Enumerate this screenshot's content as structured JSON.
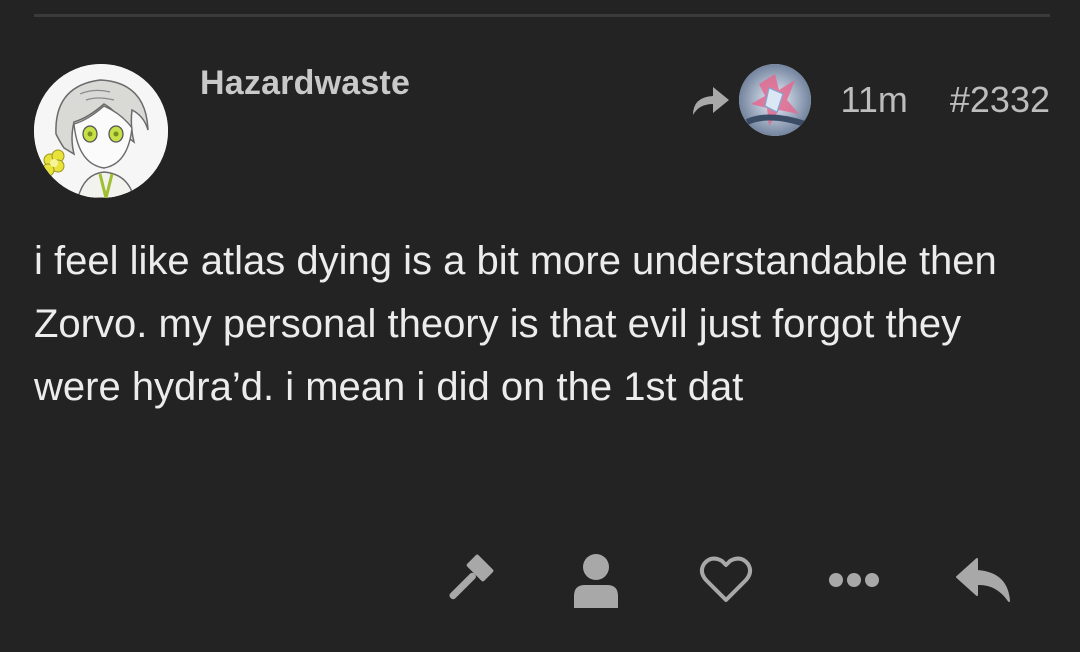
{
  "post": {
    "author": "Hazardwaste",
    "timestamp": "11m",
    "post_number": "#2332",
    "body": "i feel like atlas dying is a bit more understandable then Zorvo. my personal theory is that evil just forgot they were hydra’d. i mean i did on the 1st dat"
  },
  "icons": {
    "reply_to": "share-arrow-icon",
    "flag": "gavel-icon",
    "profile": "user-icon",
    "like": "heart-icon",
    "more": "more-dots-icon",
    "reply": "reply-icon"
  },
  "colors": {
    "background": "#232323",
    "text": "#ececec",
    "muted": "#bdbdbd",
    "icon": "#a8a8a8"
  }
}
